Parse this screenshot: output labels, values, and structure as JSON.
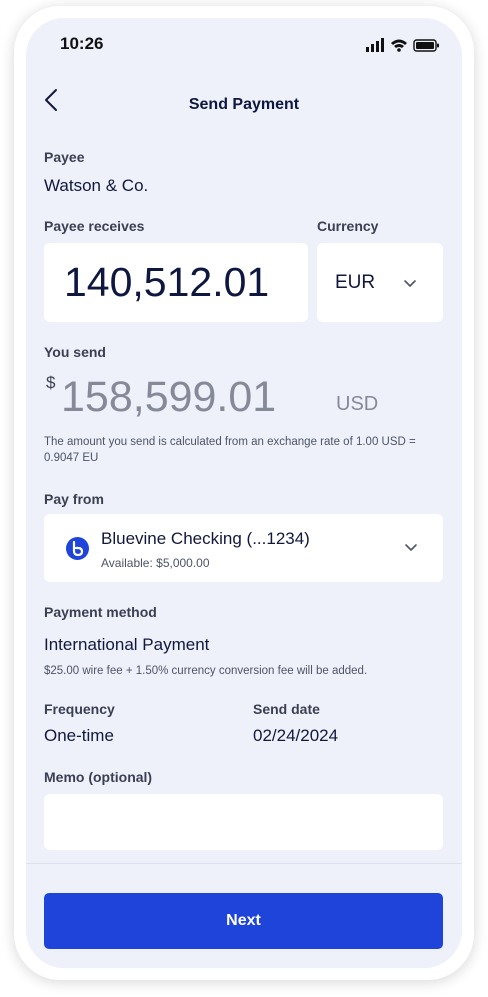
{
  "status_bar": {
    "time": "10:26"
  },
  "header": {
    "title": "Send Payment"
  },
  "payee": {
    "label": "Payee",
    "value": "Watson & Co."
  },
  "receive": {
    "label": "Payee receives",
    "amount": "140,512.01",
    "currency_label": "Currency",
    "currency_value": "EUR"
  },
  "send": {
    "label": "You send",
    "symbol": "$",
    "amount": "158,599.01",
    "currency": "USD",
    "note": "The amount you send is calculated from an exchange rate of 1.00 USD = 0.9047 EU"
  },
  "pay_from": {
    "label": "Pay from",
    "account": "Bluevine Checking (...1234)",
    "available": "Available: $5,000.00"
  },
  "payment_method": {
    "label": "Payment method",
    "value": "International Payment",
    "fee_note": "$25.00 wire fee + 1.50% currency conversion fee will be added."
  },
  "frequency": {
    "label": "Frequency",
    "value": "One-time"
  },
  "send_date": {
    "label": "Send date",
    "value": "02/24/2024"
  },
  "memo": {
    "label": "Memo (optional)",
    "value": ""
  },
  "footer": {
    "next_label": "Next"
  },
  "colors": {
    "primary": "#1f44d9",
    "background": "#eef1fa",
    "text_dark": "#12183d"
  }
}
